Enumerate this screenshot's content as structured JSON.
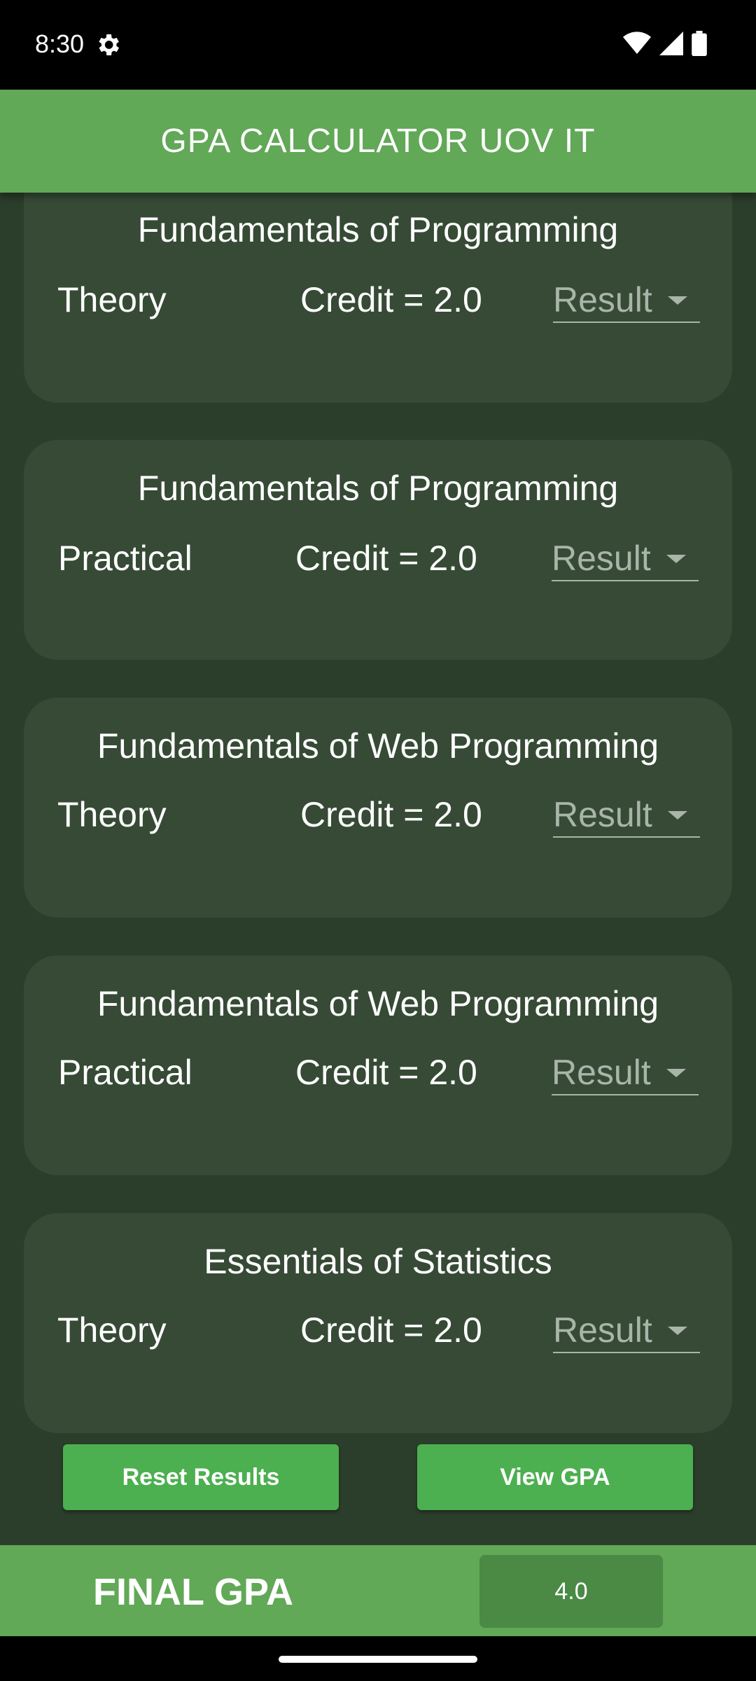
{
  "status_bar": {
    "time": "8:30",
    "icons": [
      "gear-icon",
      "wifi-icon",
      "cellular-signal-icon",
      "battery-icon"
    ]
  },
  "app_bar": {
    "title": "GPA CALCULATOR UOV IT"
  },
  "courses": [
    {
      "title": "Fundamentals of Programming",
      "kind": "Theory",
      "credit": "Credit = 2.0",
      "result_placeholder": "Result"
    },
    {
      "title": "Fundamentals of Programming",
      "kind": "Practical",
      "credit": "Credit = 2.0",
      "result_placeholder": "Result"
    },
    {
      "title": "Fundamentals of Web Programming",
      "kind": "Theory",
      "credit": "Credit = 2.0",
      "result_placeholder": "Result"
    },
    {
      "title": "Fundamentals of Web Programming",
      "kind": "Practical",
      "credit": "Credit = 2.0",
      "result_placeholder": "Result"
    },
    {
      "title": "Essentials of Statistics",
      "kind": "Theory",
      "credit": "Credit = 2.0",
      "result_placeholder": "Result"
    }
  ],
  "buttons": {
    "reset": "Reset Results",
    "view": "View GPA"
  },
  "footer": {
    "label": "FINAL GPA",
    "value": "4.0"
  },
  "colors": {
    "app_bar": "#61a857",
    "background": "#2b3d2b",
    "card": "#364a36",
    "button": "#4caf50",
    "gpa_box": "#4a8a45"
  }
}
